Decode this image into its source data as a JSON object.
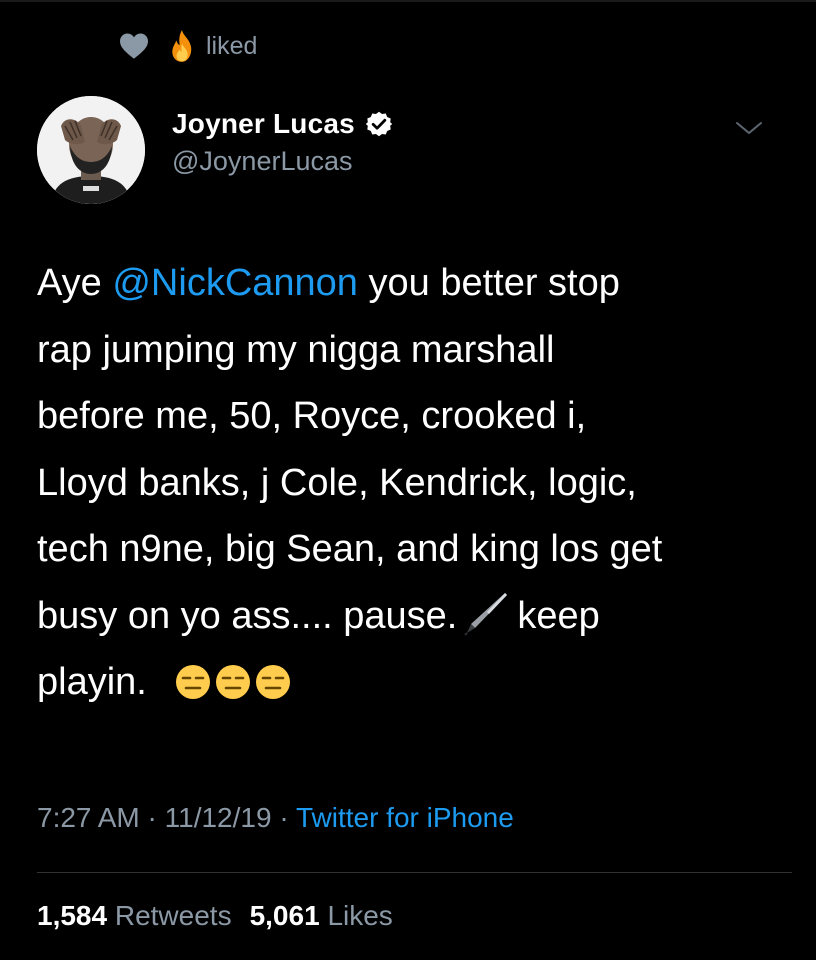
{
  "context": {
    "label": "liked",
    "icons": [
      "heart-icon",
      "fire-icon"
    ]
  },
  "author": {
    "display_name": "Joyner Lucas",
    "handle": "@JoynerLucas",
    "verified": true
  },
  "tweet": {
    "lines": [
      {
        "before": "Aye ",
        "mention": "@NickCannon",
        "after": " you better stop"
      },
      "rap jumping my nigga marshall",
      "before me, 50, Royce, crooked i,",
      "Lloyd banks, j Cole, Kendrick, logic,",
      "tech n9ne, big Sean, and king los get",
      {
        "before": "busy on yo ass.... pause.",
        "after": "keep"
      },
      "playin."
    ],
    "emojis": [
      "black-nib-emoji",
      "expressionless-face-emoji",
      "expressionless-face-emoji",
      "expressionless-face-emoji"
    ]
  },
  "meta": {
    "time": "7:27 AM",
    "separator": "·",
    "date": "11/12/19",
    "source": "Twitter for iPhone"
  },
  "stats": {
    "retweets_count": "1,584",
    "retweets_label": "Retweets",
    "likes_count": "5,061",
    "likes_label": "Likes"
  },
  "colors": {
    "background": "#000000",
    "text": "#ffffff",
    "secondary": "#8b98a5",
    "link": "#1d9bf0",
    "verified": "#ffffff"
  }
}
